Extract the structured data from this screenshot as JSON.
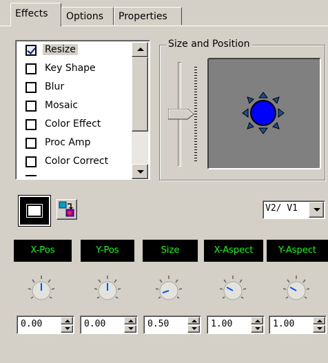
{
  "tabs": [
    {
      "label": "Effects",
      "active": true
    },
    {
      "label": "Options",
      "active": false
    },
    {
      "label": "Properties",
      "active": false
    }
  ],
  "effects_list": {
    "items": [
      {
        "label": "Resize",
        "checked": true,
        "selected": true
      },
      {
        "label": "Key Shape",
        "checked": false
      },
      {
        "label": "Blur",
        "checked": false
      },
      {
        "label": "Mosaic",
        "checked": false
      },
      {
        "label": "Color Effect",
        "checked": false
      },
      {
        "label": "Proc Amp",
        "checked": false
      },
      {
        "label": "Color Correct",
        "checked": false
      }
    ]
  },
  "size_position": {
    "title": "Size and Position",
    "pad_color": "#808080",
    "handle_color": "#0000ff",
    "arrow_color": "#1f4e8f"
  },
  "tools": {
    "button1_icon": "rectangle-icon",
    "button2_icon": "layer-transfer-icon",
    "layer_select": "V2/ V1"
  },
  "params": [
    {
      "label": "X-Pos",
      "value": "0.00"
    },
    {
      "label": "Y-Pos",
      "value": "0.00"
    },
    {
      "label": "Size",
      "value": "0.50"
    },
    {
      "label": "X-Aspect",
      "value": "1.00"
    },
    {
      "label": "Y-Aspect",
      "value": "1.00"
    }
  ],
  "colors": {
    "label_bg": "#000000",
    "label_text": "#00ff00",
    "knob_indicator": "#0055ff"
  }
}
